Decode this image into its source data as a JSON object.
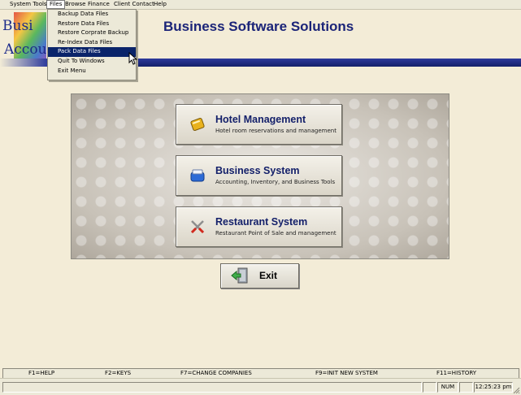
{
  "menubar": {
    "items": [
      "System Tools",
      "Files",
      "Browse",
      "Finance",
      "Client Contact",
      "Help"
    ],
    "active": "Files"
  },
  "logo": {
    "line1": "Busi",
    "line2": "Accou"
  },
  "app_title": "Business Software Solutions",
  "files_menu": {
    "items": [
      "Backup Data Files",
      "Restore Data Files",
      "Restore Corprate Backup",
      "Re-Index Data Files",
      "Pack Data Files",
      "Quit To Windows",
      "Exit Menu"
    ],
    "highlighted": "Pack Data Files"
  },
  "modules": [
    {
      "title": "Hotel Management",
      "subtitle": "Hotel room reservations and management",
      "icon": "notebook-icon"
    },
    {
      "title": "Business System",
      "subtitle": "Accounting, Inventory, and Business Tools",
      "icon": "cabinet-icon"
    },
    {
      "title": "Restaurant System",
      "subtitle": "Restaurant Point of Sale and management",
      "icon": "utensils-icon"
    }
  ],
  "exit_label": "Exit",
  "function_keys": [
    "F1=HELP",
    "F2=KEYS",
    "F7=CHANGE COMPANIES",
    "F9=INIT NEW SYSTEM",
    "F11=HISTORY"
  ],
  "status": {
    "num": "NUM",
    "time": "12:25:23 pm"
  },
  "colors": {
    "accent": "#1b2478",
    "highlight": "#0a246a",
    "background": "#f3ecd7"
  }
}
